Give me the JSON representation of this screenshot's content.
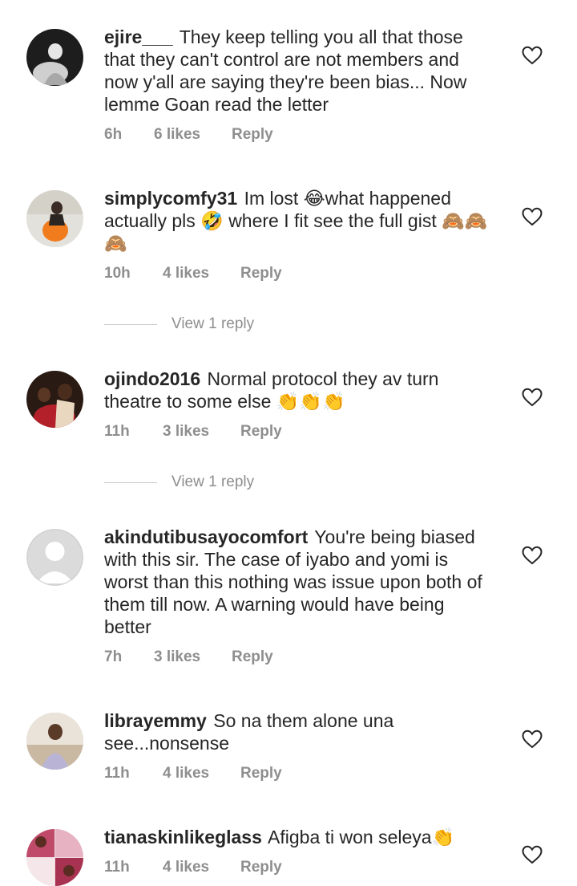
{
  "comments": [
    {
      "username": "ejire___",
      "text": "They keep telling you all that those that they can't control are not members and now y'all are saying they're been bias... Now lemme Goan read the letter",
      "time": "6h",
      "likes": "6 likes",
      "reply": "Reply",
      "avatar": "photo-dark"
    },
    {
      "username": "simplycomfy31",
      "text": "Im lost 😂what happened actually pls 🤣 where I fit see the full gist 🙈🙈🙈",
      "time": "10h",
      "likes": "4 likes",
      "reply": "Reply",
      "view_replies": "View 1 reply",
      "avatar": "photo-orange"
    },
    {
      "username": "ojindo2016",
      "text": "Normal protocol they av turn theatre to some else 👏👏👏",
      "time": "11h",
      "likes": "3 likes",
      "reply": "Reply",
      "view_replies": "View 1 reply",
      "avatar": "photo-red"
    },
    {
      "username": "akindutibusayocomfort",
      "text": "You're being biased with this sir. The  case of iyabo and yomi is worst than this nothing was issue upon both of them till now. A warning would have being better",
      "time": "7h",
      "likes": "3 likes",
      "reply": "Reply",
      "avatar": "default-silhouette"
    },
    {
      "username": "librayemmy",
      "text": "So na them alone una see...nonsense",
      "time": "11h",
      "likes": "4 likes",
      "reply": "Reply",
      "avatar": "photo-lavender"
    },
    {
      "username": "tianaskinlikeglass",
      "text": "Afigba ti won seleya👏",
      "time": "11h",
      "likes": "4 likes",
      "reply": "Reply",
      "avatar": "photo-collage"
    }
  ],
  "icons": {
    "like": "heart-outline-icon"
  },
  "colors": {
    "text": "#262626",
    "meta": "#8e8e8e",
    "divider": "#c7c7c7"
  }
}
